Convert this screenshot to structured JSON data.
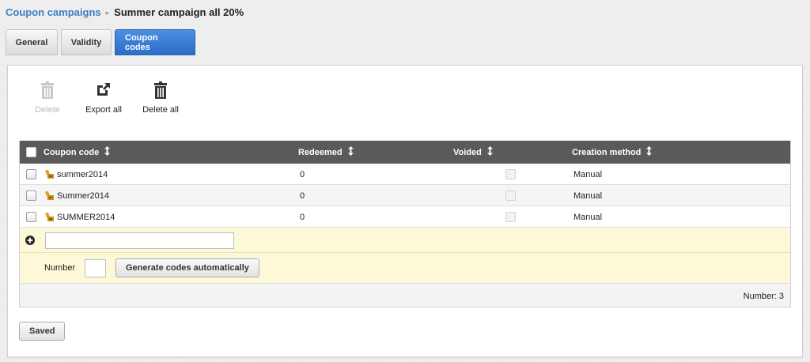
{
  "breadcrumb": {
    "parent": "Coupon campaigns",
    "separator": "▸",
    "current": "Summer campaign all 20%"
  },
  "tabs": [
    {
      "label": "General",
      "active": false
    },
    {
      "label": "Validity",
      "active": false
    },
    {
      "label": "Coupon codes",
      "active": true
    }
  ],
  "toolbar": {
    "delete_label": "Delete",
    "export_label": "Export all",
    "delete_all_label": "Delete all"
  },
  "grid": {
    "columns": [
      "Coupon code",
      "Redeemed",
      "Voided",
      "Creation method"
    ],
    "rows": [
      {
        "code": "summer2014",
        "redeemed": "0",
        "voided": false,
        "method": "Manual"
      },
      {
        "code": "Summer2014",
        "redeemed": "0",
        "voided": false,
        "method": "Manual"
      },
      {
        "code": "SUMMER2014",
        "redeemed": "0",
        "voided": false,
        "method": "Manual"
      }
    ],
    "new_code_placeholder": "",
    "number_label": "Number",
    "number_value": "",
    "generate_label": "Generate codes automatically",
    "count_text": "Number: 3"
  },
  "saved_label": "Saved",
  "colors": {
    "accent": "#3b7fc4",
    "tab_active": "#2c6dc7",
    "header_bg": "#5a5a5a",
    "add_row_bg": "#fcf8d8"
  }
}
